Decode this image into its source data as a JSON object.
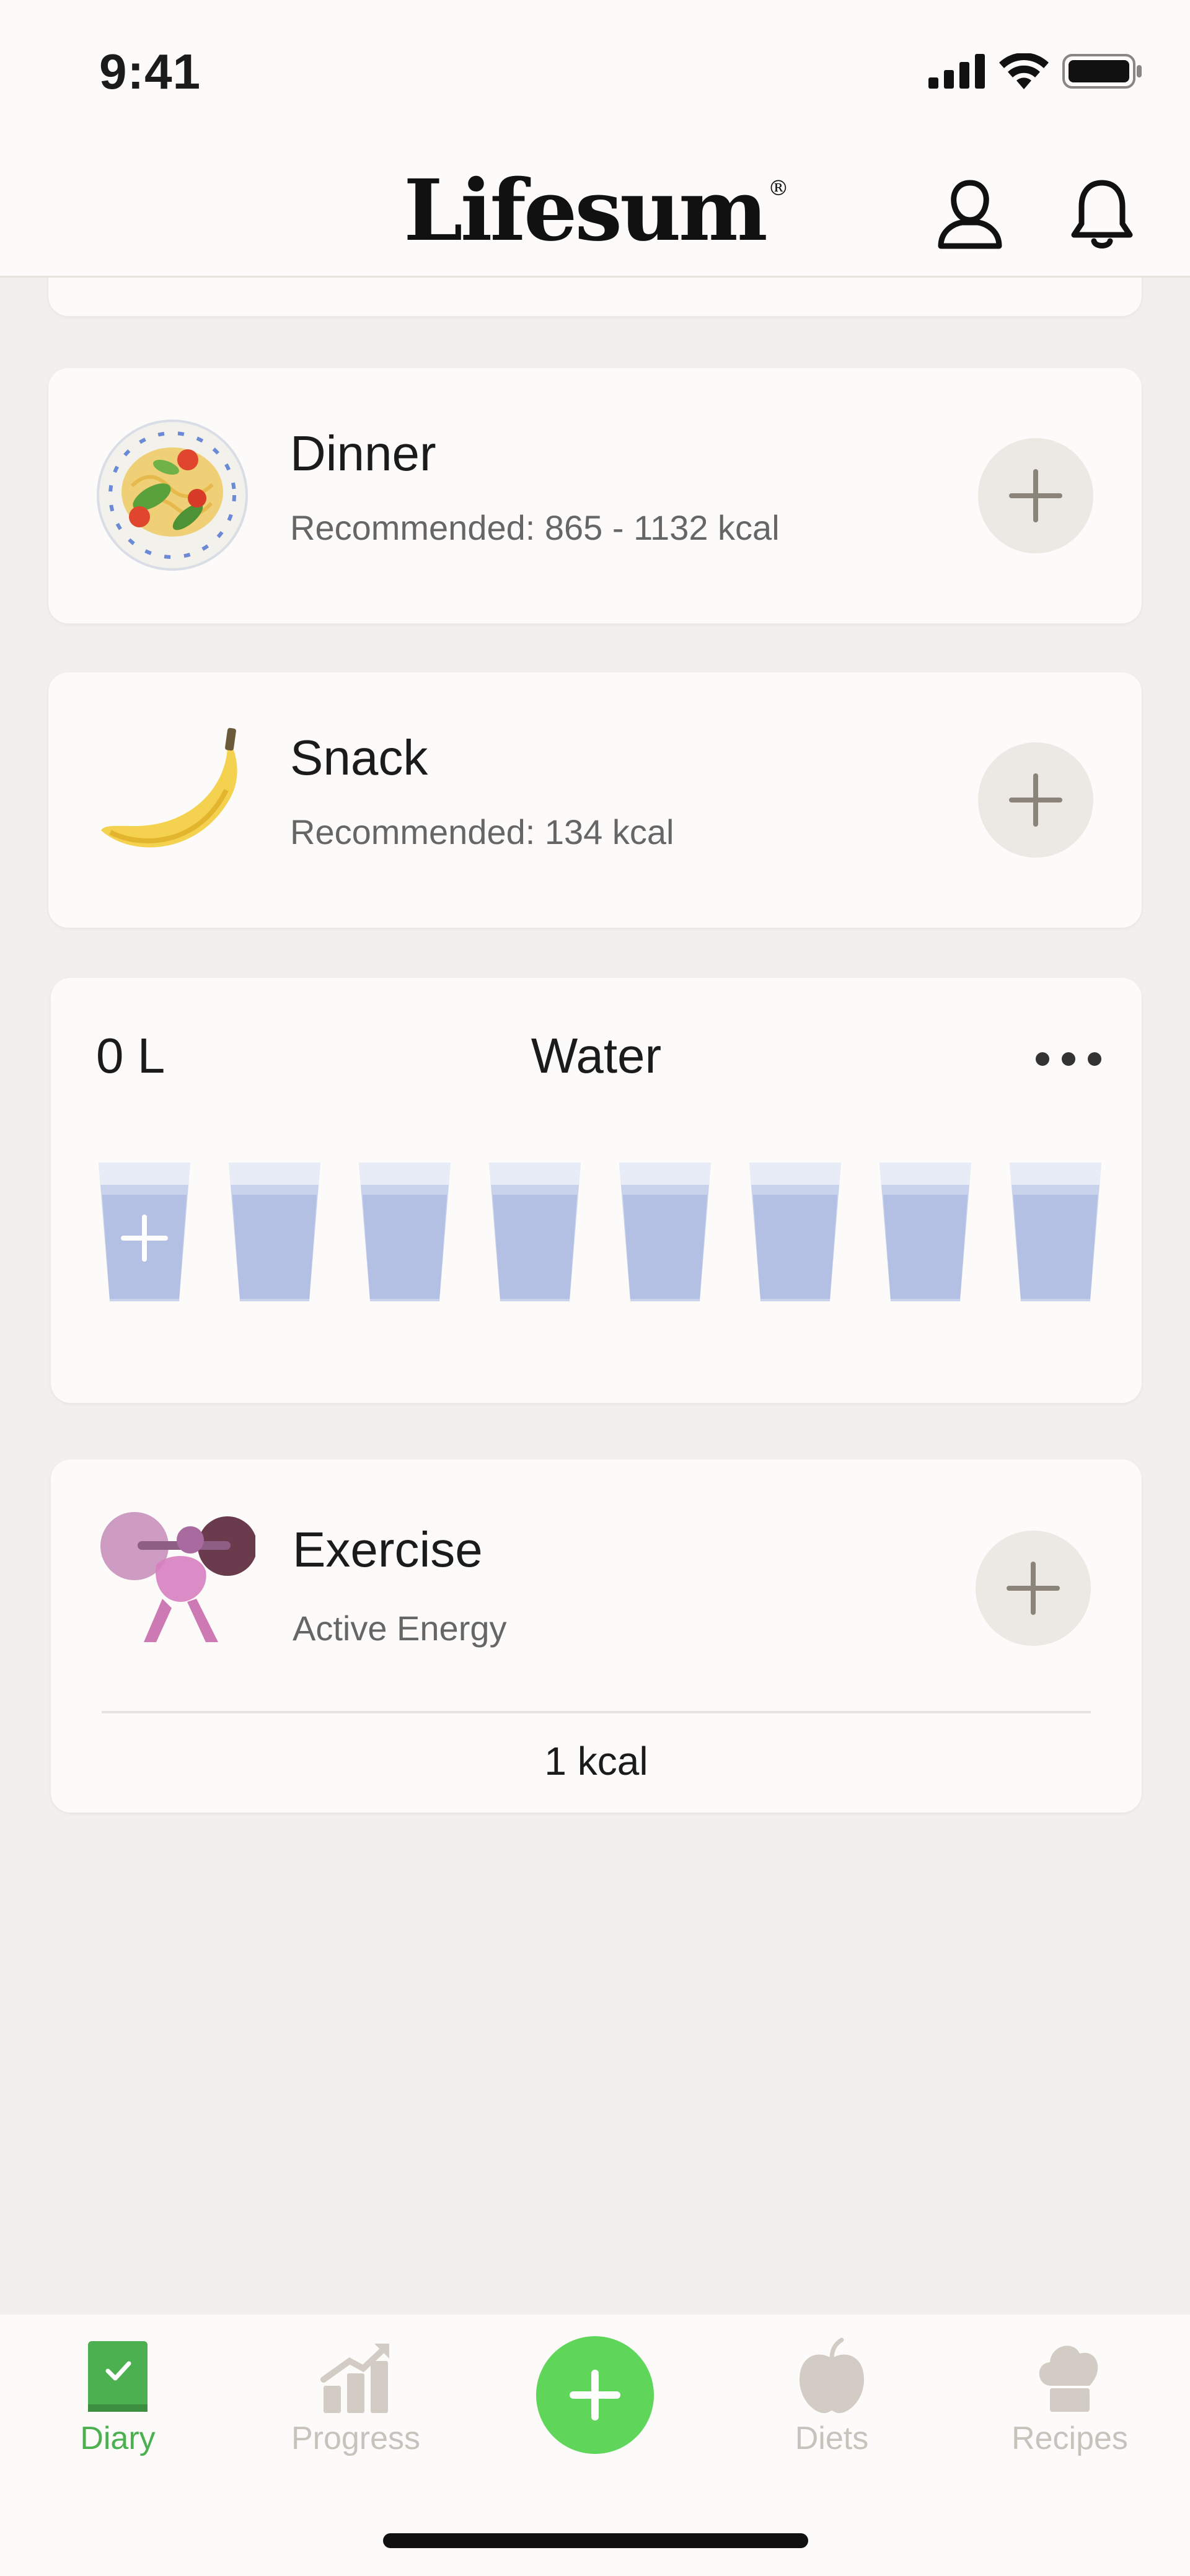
{
  "status_bar": {
    "time": "9:41"
  },
  "header": {
    "logo": "Lifesum",
    "logo_mark": "®"
  },
  "meals": [
    {
      "title": "Dinner",
      "subtitle": "Recommended: 865 - 1132  kcal",
      "icon": "pasta-plate-icon"
    },
    {
      "title": "Snack",
      "subtitle": "Recommended: 134  kcal",
      "icon": "banana-icon"
    }
  ],
  "water": {
    "amount": "0 L",
    "title": "Water",
    "glass_count": 8,
    "filled": 0
  },
  "exercise": {
    "title": "Exercise",
    "subtitle": "Active Energy",
    "kcal": "1 kcal",
    "icon": "weightlifter-icon"
  },
  "nav": {
    "diary": "Diary",
    "progress": "Progress",
    "diets": "Diets",
    "recipes": "Recipes",
    "active": "diary"
  },
  "colors": {
    "accent": "#5fd65a",
    "active_nav": "#4caf50",
    "inactive_nav": "#c7c2bb",
    "background": "#f2efec",
    "card": "#fcfbf9"
  }
}
